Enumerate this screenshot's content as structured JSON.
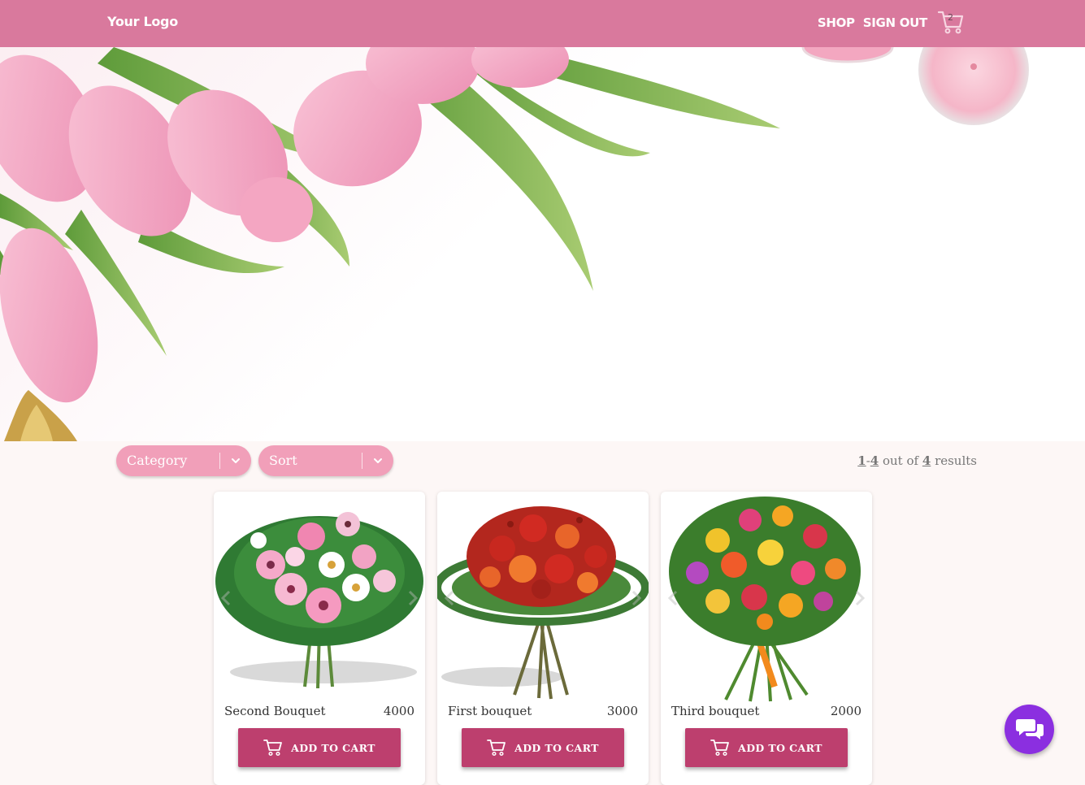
{
  "header": {
    "logo": "Your Logo",
    "nav": [
      {
        "label": "SHOP"
      },
      {
        "label": "SIGN OUT"
      }
    ],
    "cart_count": "2",
    "cart_icon": "cart-icon"
  },
  "filters": {
    "category_label": "Category",
    "sort_label": "Sort",
    "chevron_icon": "chevron-down-icon"
  },
  "results": {
    "range_start": "1",
    "range_end": "4",
    "middle": "out of",
    "total": "4",
    "suffix": "results"
  },
  "products": [
    {
      "name": "Second Bouquet",
      "price": "4000",
      "button": "ADD TO CART"
    },
    {
      "name": "First bouquet",
      "price": "3000",
      "button": "ADD TO CART"
    },
    {
      "name": "Third bouquet",
      "price": "2000",
      "button": "ADD TO CART"
    }
  ],
  "chat": {
    "icon": "chat-icon"
  },
  "colors": {
    "header": "#d9799d",
    "select": "#f19fb9",
    "button": "#bd3f6e",
    "chat": "#8b2fe0"
  }
}
